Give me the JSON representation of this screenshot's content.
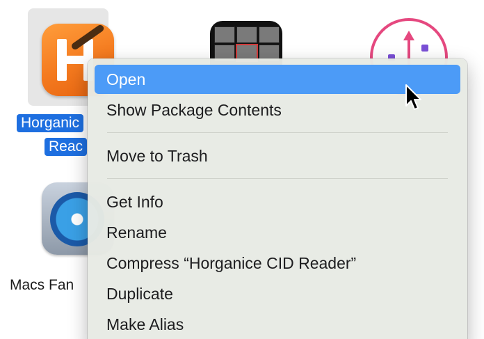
{
  "desktop": {
    "apps": [
      {
        "label_line1": "Horganic",
        "label_line2": "Reac"
      },
      {
        "label": "Macs Fan"
      }
    ]
  },
  "context_menu": {
    "items": [
      {
        "label": "Open",
        "highlighted": true
      },
      {
        "label": "Show Package Contents"
      },
      {
        "label": "Move to Trash"
      },
      {
        "label": "Get Info"
      },
      {
        "label": "Rename"
      },
      {
        "label": "Compress “Horganice CID Reader”"
      },
      {
        "label": "Duplicate"
      },
      {
        "label": "Make Alias"
      }
    ]
  },
  "colors": {
    "highlight": "#4c9bf7",
    "selection_label": "#1e6fe0",
    "menu_background": "#e7eae4",
    "app_icon_orange": "#f47a1f"
  },
  "icons": {
    "horganice": "horganice-app-icon",
    "photos": "photo-grid-app-icon",
    "share": "ring-share-app-icon",
    "fan": "macs-fan-app-icon",
    "cursor": "mouse-pointer-icon"
  }
}
